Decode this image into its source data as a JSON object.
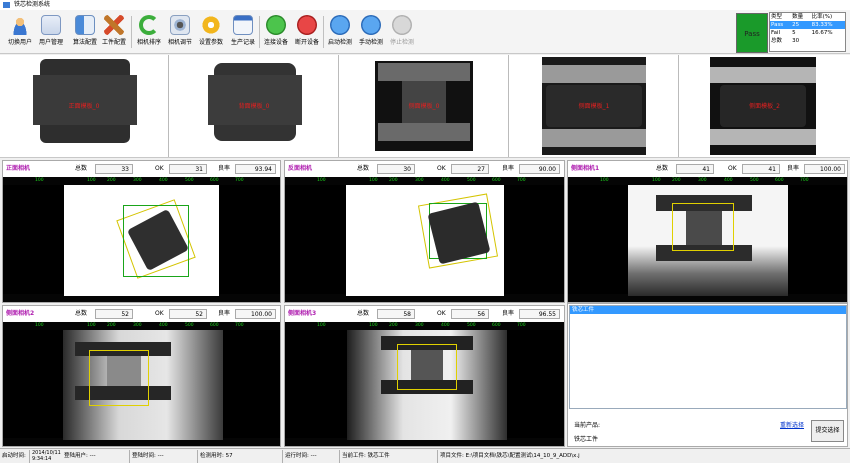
{
  "window": {
    "title": "铁芯检测系统"
  },
  "toolbar": {
    "buttons": [
      {
        "label": "切换用户",
        "icon": "user-icon"
      },
      {
        "label": "用户管理",
        "icon": "user-manage-icon"
      },
      {
        "label": "算法配置",
        "icon": "algorithm-icon"
      },
      {
        "label": "工件配置",
        "icon": "tools-icon"
      },
      {
        "label": "相机排序",
        "icon": "refresh-icon"
      },
      {
        "label": "相机调节",
        "icon": "camera-icon"
      },
      {
        "label": "设置参数",
        "icon": "gear-icon"
      },
      {
        "label": "生产记录",
        "icon": "calendar-icon"
      },
      {
        "label": "连接设备",
        "icon": "check-icon"
      },
      {
        "label": "断开设备",
        "icon": "stop-icon"
      },
      {
        "label": "启动检测",
        "icon": "play-icon"
      },
      {
        "label": "手动检测",
        "icon": "step-icon"
      },
      {
        "label": "停止检测",
        "icon": "pause-icon"
      }
    ]
  },
  "result": {
    "status": "Pass"
  },
  "stats": {
    "headers": [
      "类型",
      "数量",
      "比率(%)"
    ],
    "rows": [
      {
        "type": "Pass",
        "count": "25",
        "ratio": "83.33%"
      },
      {
        "type": "Fail",
        "count": "5",
        "ratio": "16.67%"
      },
      {
        "type": "总数",
        "count": "30",
        "ratio": ""
      }
    ]
  },
  "templates": [
    {
      "label": "正面模板_0"
    },
    {
      "label": "背面模板_0"
    },
    {
      "label": "侧面模板_0"
    },
    {
      "label": "侧面模板_1"
    },
    {
      "label": "侧面模板_2"
    }
  ],
  "labels": {
    "total": "总数",
    "ok": "OK",
    "yield": "良率"
  },
  "cameras": [
    {
      "name": "正面相机",
      "total": "33",
      "ok": "31",
      "yield": "93.94"
    },
    {
      "name": "反面相机",
      "total": "30",
      "ok": "27",
      "yield": "90.00"
    },
    {
      "name": "侧面相机1",
      "total": "41",
      "ok": "41",
      "yield": "100.00"
    },
    {
      "name": "侧面相机2",
      "total": "52",
      "ok": "52",
      "yield": "100.00"
    },
    {
      "name": "侧面相机3",
      "total": "58",
      "ok": "56",
      "yield": "96.55"
    }
  ],
  "ruler": {
    "ticks": [
      "100",
      "100",
      "200",
      "300",
      "400",
      "500",
      "600",
      "700"
    ]
  },
  "side": {
    "list_selected": "铁芯工件",
    "current_product_label": "当前产品:",
    "reselect_link": "重新选择",
    "product_name": "铁芯工件",
    "submit_button": "提交选择"
  },
  "status": {
    "start_time_label": "启动时间:",
    "start_date": "2014/10/11",
    "start_clock": "9:34:14",
    "login_user_label": "登陆用户:",
    "login_user": "---",
    "login_time_label": "登陆时间:",
    "login_time": "---",
    "detect_time_label": "检测用时:",
    "detect_time": "57",
    "run_time_label": "运行时间:",
    "run_time": "---",
    "workpiece_label": "当前工件:",
    "workpiece": "铁芯工件",
    "project_label": "项目文件:",
    "project_file": "E:\\项目文档\\铁芯\\配置测试\\14_10_9_ADD\\x.j"
  }
}
